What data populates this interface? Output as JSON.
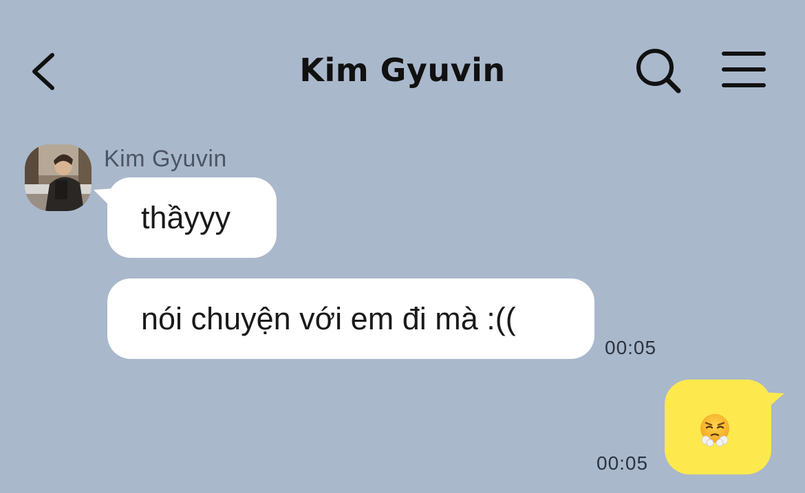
{
  "header": {
    "title": "Kim Gyuvin",
    "back_icon": "chevron-left-icon",
    "search_icon": "search-icon",
    "menu_icon": "hamburger-menu-icon"
  },
  "colors": {
    "background": "#a9b8cb",
    "incoming_bubble": "#ffffff",
    "outgoing_bubble": "#fde84e"
  },
  "messages": [
    {
      "direction": "incoming",
      "sender": "Kim Gyuvin",
      "text": "thầyyy"
    },
    {
      "direction": "incoming",
      "sender": "Kim Gyuvin",
      "text": "nói chuyện với em đi mà :((",
      "time": "00:05"
    },
    {
      "direction": "outgoing",
      "emoji": "face-with-steam-from-nose-emoji",
      "time": "00:05"
    }
  ]
}
